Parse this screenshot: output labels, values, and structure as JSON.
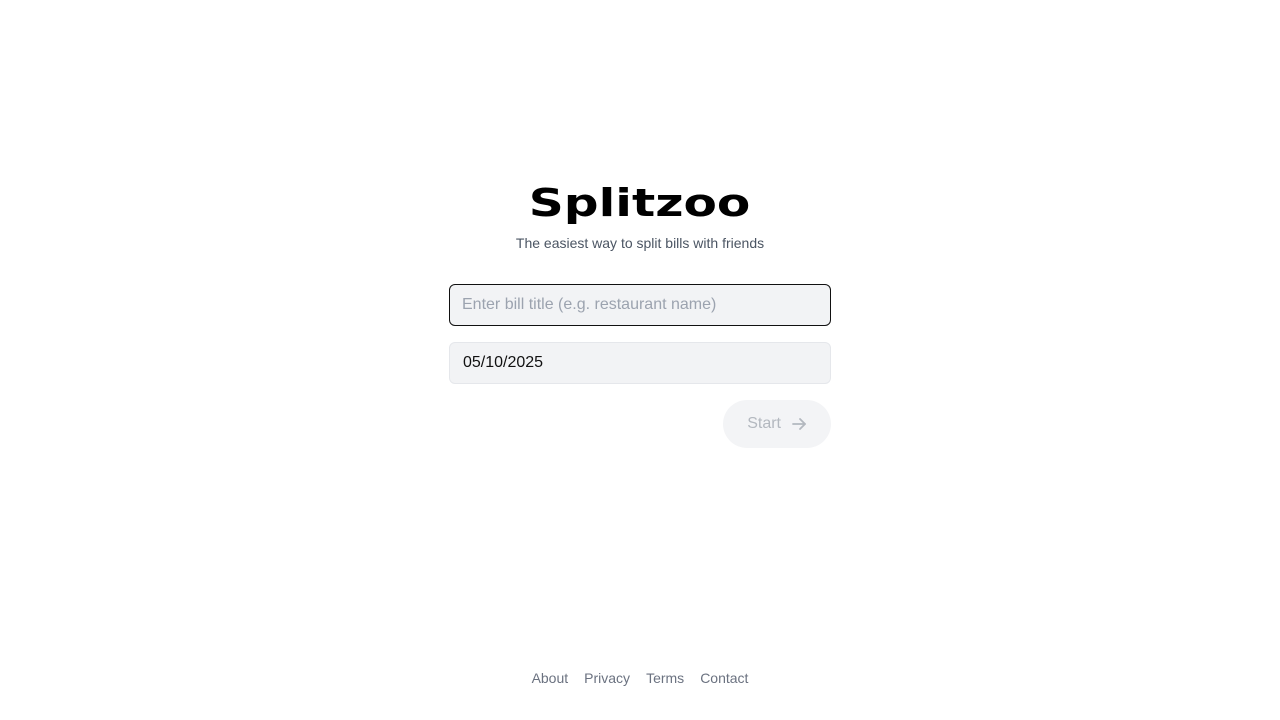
{
  "brand": {
    "logo_text": "Splitzoo",
    "tagline": "The easiest way to split bills with friends"
  },
  "form": {
    "title_input": {
      "value": "",
      "placeholder": "Enter bill title (e.g. restaurant name)"
    },
    "date_input": {
      "value": "05/10/2025"
    },
    "start_button": {
      "label": "Start",
      "icon": "arrow-right-icon",
      "disabled": true
    }
  },
  "footer": {
    "links": [
      {
        "label": "About"
      },
      {
        "label": "Privacy"
      },
      {
        "label": "Terms"
      },
      {
        "label": "Contact"
      }
    ]
  },
  "colors": {
    "background": "#ffffff",
    "field_bg": "#f2f3f5",
    "focus_border": "#111111",
    "muted_text": "#6b7280",
    "disabled_text": "#b3b8bf"
  }
}
